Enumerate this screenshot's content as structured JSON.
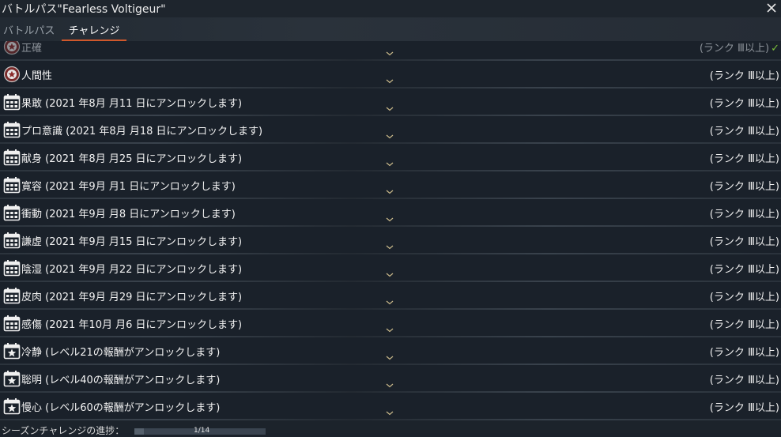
{
  "window": {
    "title": "バトルパス\"Fearless Voltigeur\"",
    "close_icon": "close-icon"
  },
  "tabs": [
    {
      "label": "バトルパス",
      "active": false
    },
    {
      "label": "チャレンジ",
      "active": true
    }
  ],
  "colors": {
    "accent": "#d0582b",
    "check": "#7bbf3a",
    "background": "#1a212a"
  },
  "challenges": [
    {
      "name": "正確",
      "rank": "(ランク Ⅲ以上)",
      "icon": "badge-icon",
      "completed": true
    },
    {
      "name": "人間性",
      "rank": "(ランク Ⅲ以上)",
      "icon": "badge-icon",
      "completed": false
    },
    {
      "name": "果敢 (2021 年8月 月11 日にアンロックします)",
      "rank": "(ランク Ⅲ以上)",
      "icon": "calendar-icon",
      "completed": false
    },
    {
      "name": "プロ意識 (2021 年8月 月18 日にアンロックします)",
      "rank": "(ランク Ⅲ以上)",
      "icon": "calendar-icon",
      "completed": false
    },
    {
      "name": "献身 (2021 年8月 月25 日にアンロックします)",
      "rank": "(ランク Ⅲ以上)",
      "icon": "calendar-icon",
      "completed": false
    },
    {
      "name": "寛容 (2021 年9月 月1 日にアンロックします)",
      "rank": "(ランク Ⅲ以上)",
      "icon": "calendar-icon",
      "completed": false
    },
    {
      "name": "衝動 (2021 年9月 月8 日にアンロックします)",
      "rank": "(ランク Ⅲ以上)",
      "icon": "calendar-icon",
      "completed": false
    },
    {
      "name": "謙虚 (2021 年9月 月15 日にアンロックします)",
      "rank": "(ランク Ⅲ以上)",
      "icon": "calendar-icon",
      "completed": false
    },
    {
      "name": "陰湿 (2021 年9月 月22 日にアンロックします)",
      "rank": "(ランク Ⅲ以上)",
      "icon": "calendar-icon",
      "completed": false
    },
    {
      "name": "皮肉 (2021 年9月 月29 日にアンロックします)",
      "rank": "(ランク Ⅲ以上)",
      "icon": "calendar-icon",
      "completed": false
    },
    {
      "name": "感傷 (2021 年10月 月6 日にアンロックします)",
      "rank": "(ランク Ⅲ以上)",
      "icon": "calendar-icon",
      "completed": false
    },
    {
      "name": "冷静 (レベル21の報酬がアンロックします)",
      "rank": "(ランク Ⅲ以上)",
      "icon": "star-calendar-icon",
      "completed": false
    },
    {
      "name": "聡明 (レベル40の報酬がアンロックします)",
      "rank": "(ランク Ⅲ以上)",
      "icon": "star-calendar-icon",
      "completed": false
    },
    {
      "name": "慢心 (レベル60の報酬がアンロックします)",
      "rank": "(ランク Ⅲ以上)",
      "icon": "star-calendar-icon",
      "completed": false
    }
  ],
  "footer": {
    "label": "シーズンチャレンジの進捗：",
    "progress_text": "1/14",
    "progress_fraction": 0.0714
  }
}
